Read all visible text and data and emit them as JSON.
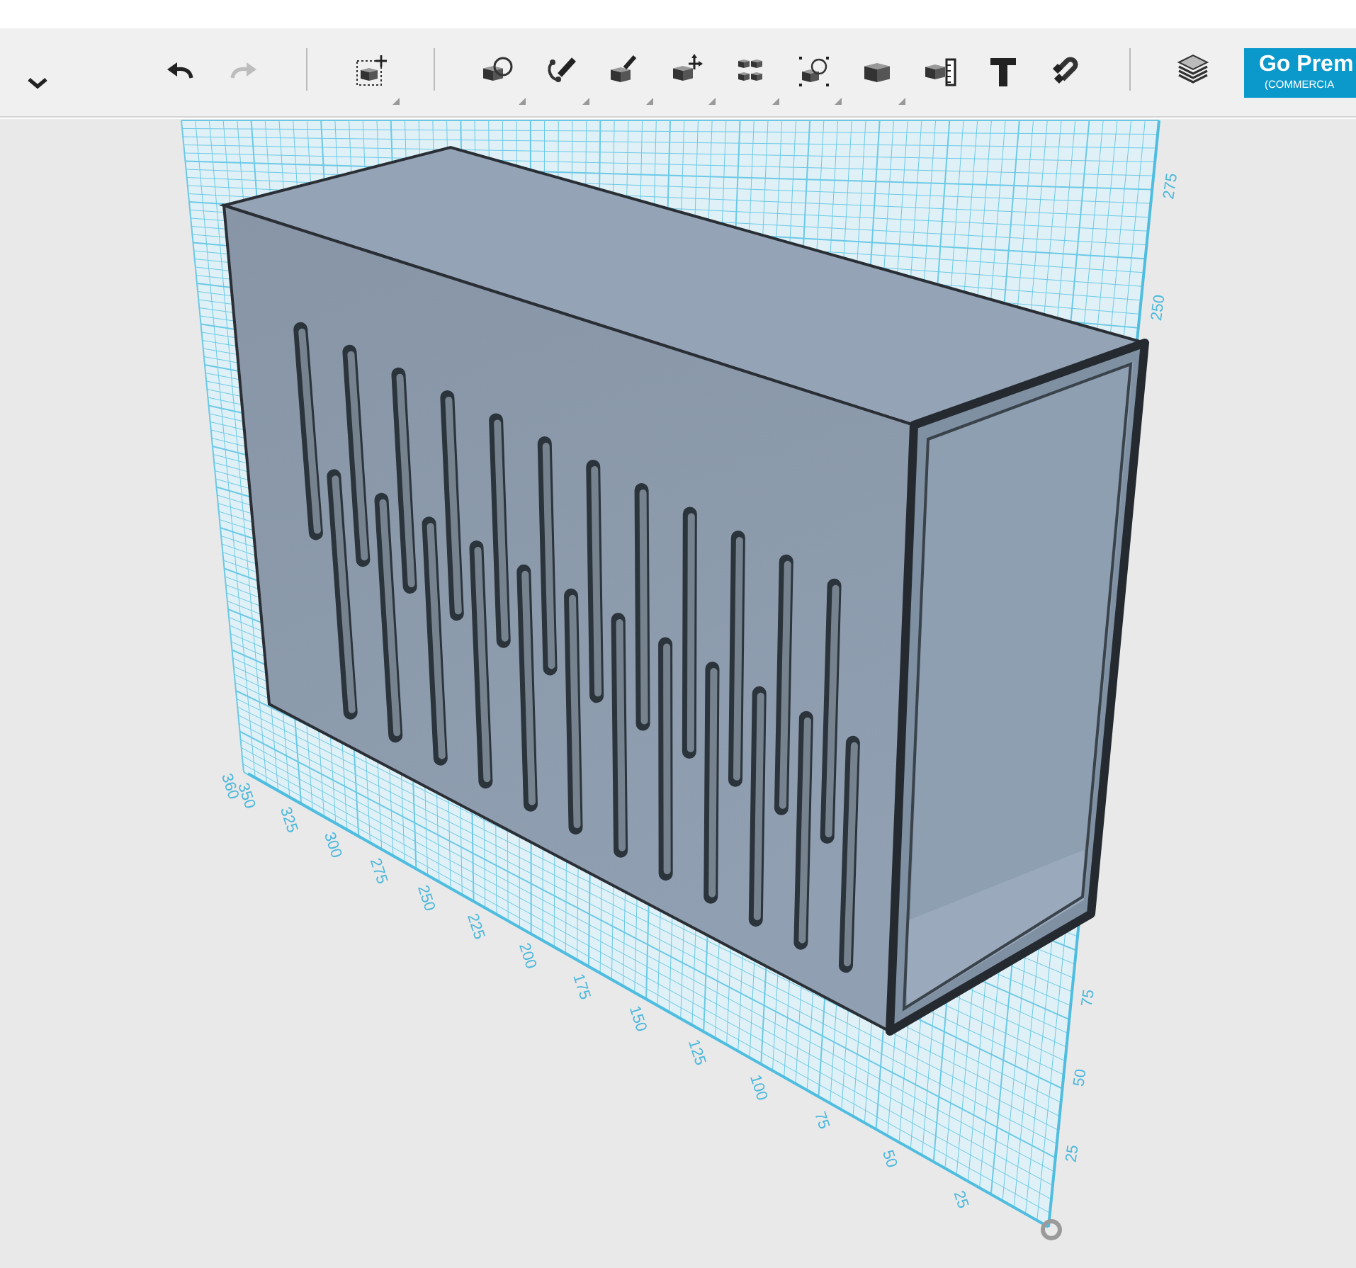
{
  "toolbar": {
    "items": [
      {
        "kind": "menu",
        "disabled": false,
        "submenu": false
      },
      {
        "kind": "undo",
        "disabled": false,
        "submenu": false
      },
      {
        "kind": "redo",
        "disabled": true,
        "submenu": false
      },
      {
        "kind": "separator"
      },
      {
        "kind": "transform",
        "disabled": false,
        "submenu": true
      },
      {
        "kind": "separator"
      },
      {
        "kind": "primitives",
        "disabled": false,
        "submenu": true
      },
      {
        "kind": "sketch",
        "disabled": false,
        "submenu": true
      },
      {
        "kind": "construct",
        "disabled": false,
        "submenu": true
      },
      {
        "kind": "modify",
        "disabled": false,
        "submenu": true
      },
      {
        "kind": "pattern",
        "disabled": false,
        "submenu": true
      },
      {
        "kind": "group",
        "disabled": false,
        "submenu": true
      },
      {
        "kind": "combine",
        "disabled": false,
        "submenu": true
      },
      {
        "kind": "measure",
        "disabled": false,
        "submenu": false
      },
      {
        "kind": "text",
        "disabled": false,
        "submenu": false
      },
      {
        "kind": "snap",
        "disabled": false,
        "submenu": false
      },
      {
        "kind": "separator"
      },
      {
        "kind": "layers",
        "disabled": false,
        "submenu": false
      }
    ],
    "premium_button": {
      "label": "Go Prem",
      "sublabel": "(COMMERCIA"
    }
  },
  "viewport": {
    "floor_axis_labels": [
      "360",
      "350",
      "325",
      "300",
      "275",
      "250",
      "225",
      "200",
      "175",
      "150",
      "125",
      "100",
      "75",
      "50",
      "25"
    ],
    "vertical_axis_labels": [
      "25",
      "50",
      "75",
      "250",
      "275"
    ]
  }
}
